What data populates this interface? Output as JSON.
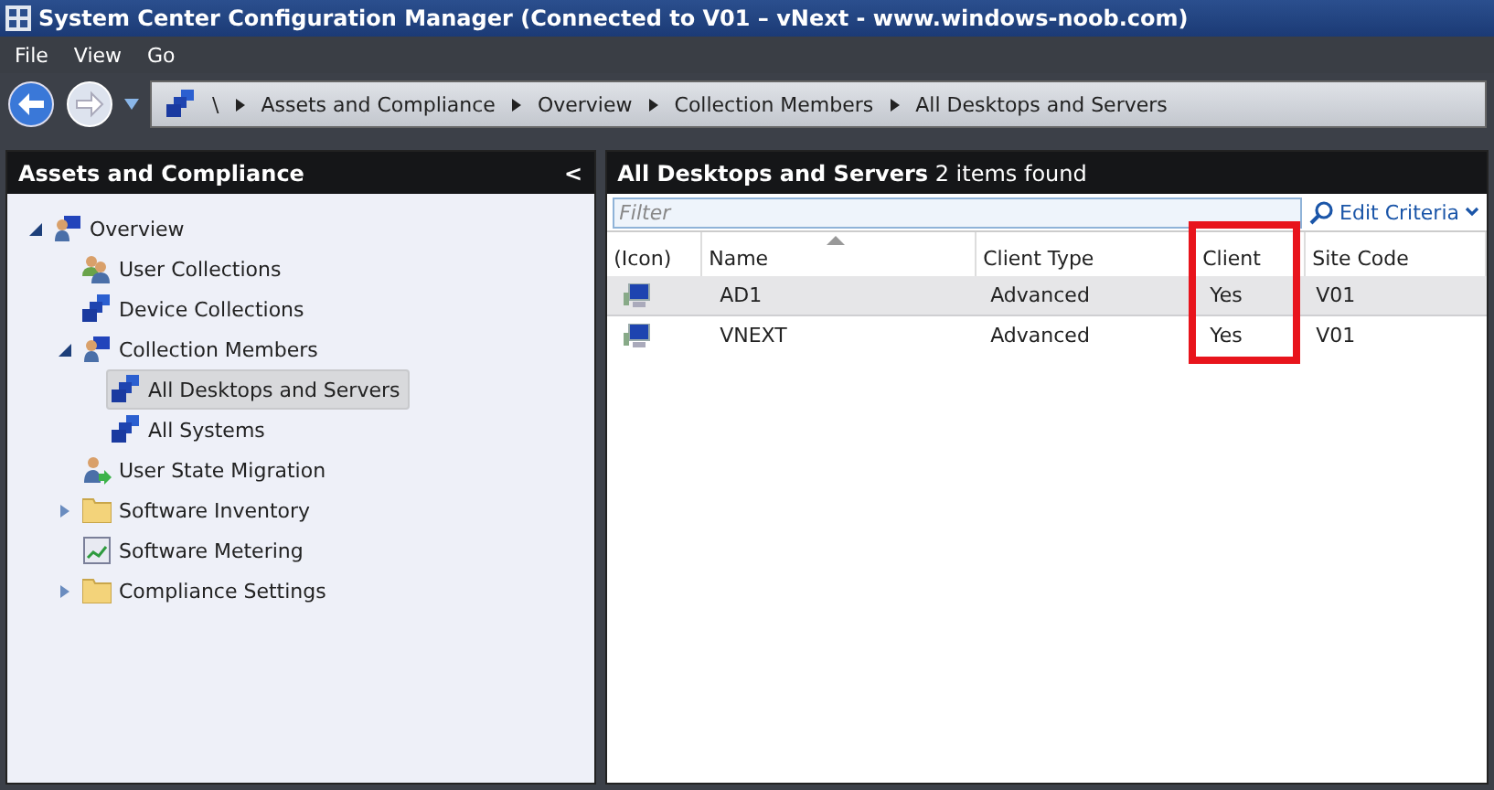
{
  "window": {
    "title": "System Center Configuration Manager (Connected to V01 – vNext - www.windows-noob.com)"
  },
  "menu": [
    "File",
    "View",
    "Go"
  ],
  "breadcrumb": [
    "\\",
    "Assets and Compliance",
    "Overview",
    "Collection Members",
    "All Desktops and Servers"
  ],
  "sidebar": {
    "title": "Assets and Compliance",
    "collapse": "<",
    "items": [
      {
        "label": "Overview",
        "kind": "computer-user",
        "expanded": true,
        "selected": false,
        "children": [
          {
            "label": "User Collections",
            "kind": "users",
            "selected": false
          },
          {
            "label": "Device Collections",
            "kind": "computers",
            "selected": false
          },
          {
            "label": "Collection Members",
            "kind": "computer-user",
            "expanded": true,
            "selected": false,
            "children": [
              {
                "label": "All Desktops and Servers",
                "kind": "computers",
                "selected": true
              },
              {
                "label": "All Systems",
                "kind": "computers",
                "selected": false
              }
            ]
          },
          {
            "label": "User State Migration",
            "kind": "user-arrow",
            "selected": false
          },
          {
            "label": "Software Inventory",
            "kind": "folder",
            "expanded": false,
            "selected": false
          },
          {
            "label": "Software Metering",
            "kind": "meter",
            "selected": false
          },
          {
            "label": "Compliance Settings",
            "kind": "folder",
            "expanded": false,
            "selected": false
          }
        ]
      }
    ]
  },
  "main": {
    "title": "All Desktops and Servers",
    "count": "2 items found",
    "filter": {
      "placeholder": "Filter"
    },
    "edit_criteria": "Edit Criteria",
    "table": {
      "columns": [
        {
          "label": "(Icon)",
          "highlighted": false
        },
        {
          "label": "Name",
          "highlighted": false
        },
        {
          "label": "Client Type",
          "highlighted": false
        },
        {
          "label": "Client",
          "highlighted": true
        },
        {
          "label": "Site Code",
          "highlighted": false
        }
      ],
      "rows": [
        {
          "name": "AD1",
          "client_type": "Advanced",
          "client": "Yes",
          "site_code": "V01",
          "selected": true
        },
        {
          "name": "VNEXT",
          "client_type": "Advanced",
          "client": "Yes",
          "site_code": "V01",
          "selected": false
        }
      ]
    }
  }
}
